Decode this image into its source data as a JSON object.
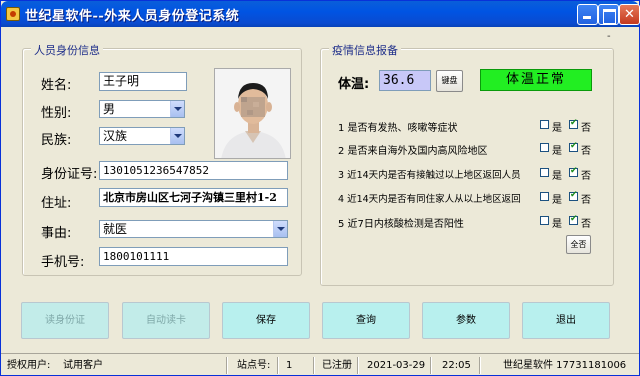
{
  "window": {
    "title": "世纪星软件--外来人员身份登记系统",
    "minimize_label": "",
    "maximize_label": "",
    "close_label": "",
    "corner_mark": "-"
  },
  "person": {
    "legend": "人员身份信息",
    "name_label": "姓名:",
    "name_value": "王子明",
    "gender_label": "性别:",
    "gender_value": "男",
    "ethnicity_label": "民族:",
    "ethnicity_value": "汉族",
    "id_label": "身份证号:",
    "id_value": "1301051236547852",
    "address_label": "住址:",
    "address_value": "北京市房山区七河子沟镇三里村1-2",
    "reason_label": "事由:",
    "reason_value": "就医",
    "phone_label": "手机号:",
    "phone_value": "1800101111"
  },
  "epidemic": {
    "legend": "疫情信息报备",
    "temp_label": "体温:",
    "temp_value": "36.6",
    "keyboard_button": "键盘",
    "status": "体温正常",
    "yes_label": "是",
    "no_label": "否",
    "questions": [
      {
        "text": "1 是否有发热、咳嗽等症状",
        "yes": false,
        "no": true
      },
      {
        "text": "2 是否来自海外及国内高风险地区",
        "yes": false,
        "no": true
      },
      {
        "text": "3 近14天内是否有接触过以上地区返回人员",
        "yes": false,
        "no": true
      },
      {
        "text": "4 近14天内是否有同住家人从以上地区返回",
        "yes": false,
        "no": true
      },
      {
        "text": "5 近7日内核酸检测是否阳性",
        "yes": false,
        "no": true
      }
    ],
    "all_no_button": "全否"
  },
  "actions": {
    "read_id": "读身份证",
    "auto_read": "自动读卡",
    "save": "保存",
    "query": "查询",
    "params": "参数",
    "exit": "退出"
  },
  "statusbar": {
    "user_label": "授权用户:",
    "user_value": "试用客户",
    "site_label": "站点号:",
    "site_value": "1",
    "registered": "已注册",
    "date": "2021-03-29",
    "time": "22:05",
    "vendor": "世纪星软件 17731181006"
  },
  "colors": {
    "status_ok": "#22ee22",
    "temp_box": "#c8c8f8",
    "button_enabled": "#b8f0ee",
    "titlebar": "#0054e3"
  }
}
